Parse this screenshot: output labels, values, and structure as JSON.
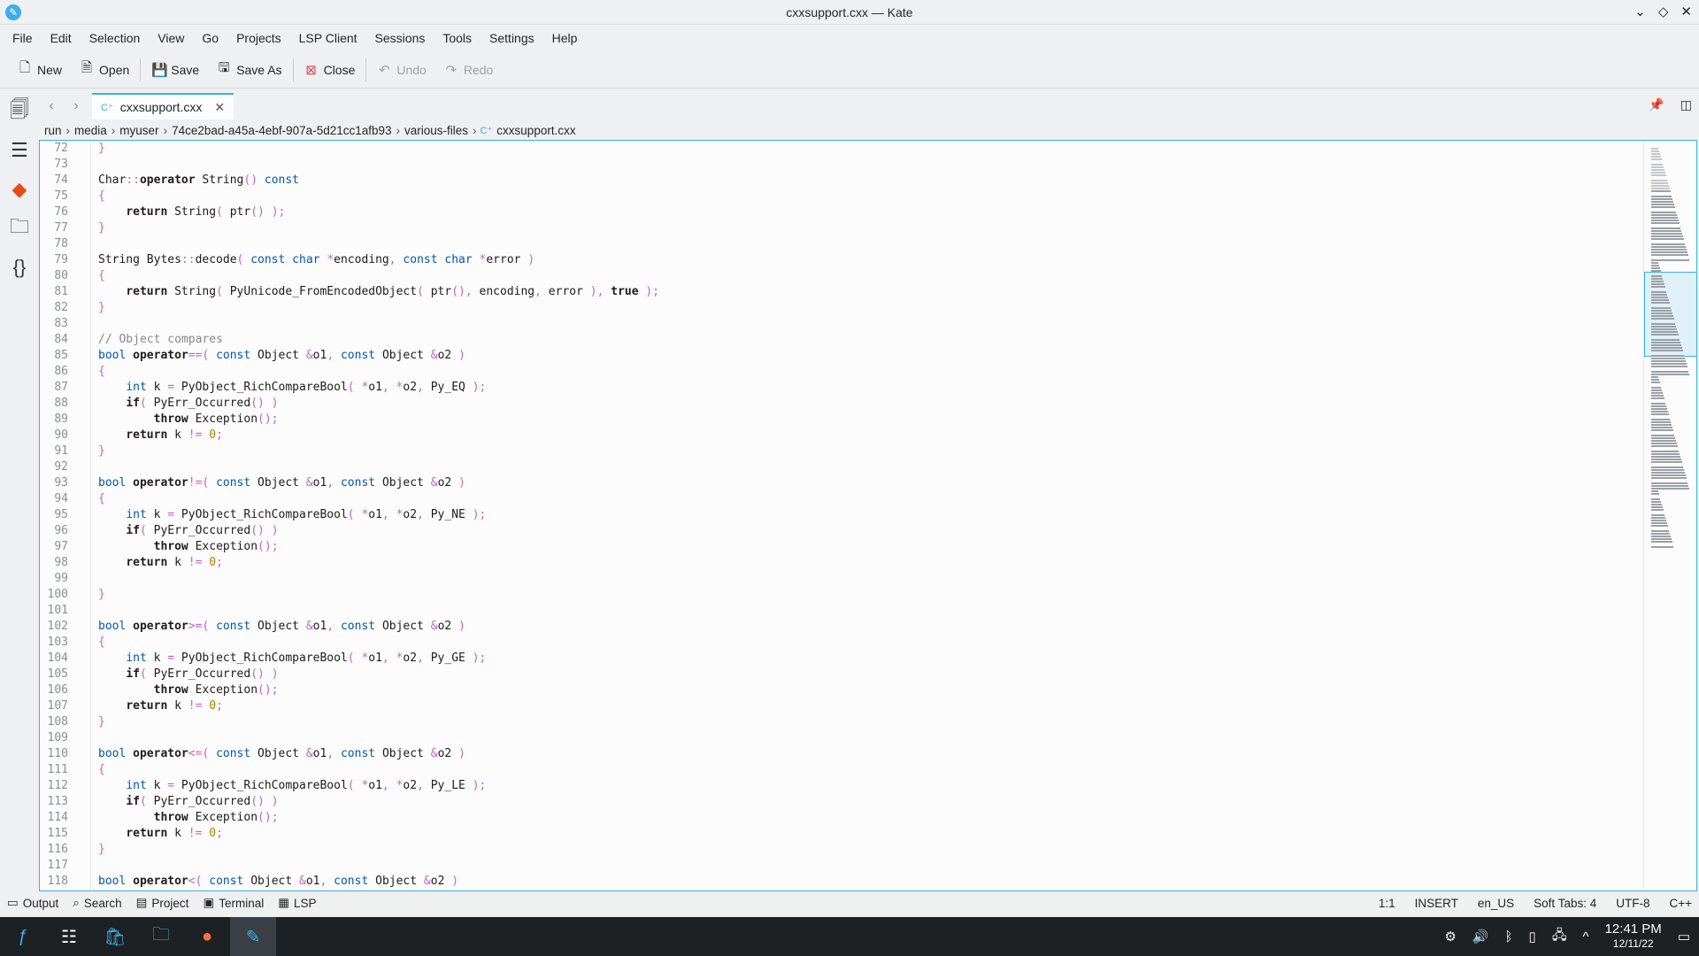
{
  "window": {
    "title": "cxxsupport.cxx — Kate"
  },
  "menu": [
    "File",
    "Edit",
    "Selection",
    "View",
    "Go",
    "Projects",
    "LSP Client",
    "Sessions",
    "Tools",
    "Settings",
    "Help"
  ],
  "toolbar": {
    "new": "New",
    "open": "Open",
    "save": "Save",
    "save_as": "Save As",
    "close": "Close",
    "undo": "Undo",
    "redo": "Redo"
  },
  "tab": {
    "label": "cxxsupport.cxx"
  },
  "breadcrumb": [
    "run",
    "media",
    "myuser",
    "74ce2bad-a45a-4ebf-907a-5d21cc1afb93",
    "various-files",
    "cxxsupport.cxx"
  ],
  "code": [
    {
      "n": "72",
      "t": "}"
    },
    {
      "n": "73",
      "t": ""
    },
    {
      "n": "74",
      "t": "Char::operator String() const"
    },
    {
      "n": "75",
      "t": "{"
    },
    {
      "n": "76",
      "t": "    return String( ptr() );"
    },
    {
      "n": "77",
      "t": "}"
    },
    {
      "n": "78",
      "t": ""
    },
    {
      "n": "79",
      "t": "String Bytes::decode( const char *encoding, const char *error )"
    },
    {
      "n": "80",
      "t": "{"
    },
    {
      "n": "81",
      "t": "    return String( PyUnicode_FromEncodedObject( ptr(), encoding, error ), true );"
    },
    {
      "n": "82",
      "t": "}"
    },
    {
      "n": "83",
      "t": ""
    },
    {
      "n": "84",
      "t": "// Object compares"
    },
    {
      "n": "85",
      "t": "bool operator==( const Object &o1, const Object &o2 )"
    },
    {
      "n": "86",
      "t": "{"
    },
    {
      "n": "87",
      "t": "    int k = PyObject_RichCompareBool( *o1, *o2, Py_EQ );"
    },
    {
      "n": "88",
      "t": "    if( PyErr_Occurred() )"
    },
    {
      "n": "89",
      "t": "        throw Exception();"
    },
    {
      "n": "90",
      "t": "    return k != 0;"
    },
    {
      "n": "91",
      "t": "}"
    },
    {
      "n": "92",
      "t": ""
    },
    {
      "n": "93",
      "t": "bool operator!=( const Object &o1, const Object &o2 )"
    },
    {
      "n": "94",
      "t": "{"
    },
    {
      "n": "95",
      "t": "    int k = PyObject_RichCompareBool( *o1, *o2, Py_NE );"
    },
    {
      "n": "96",
      "t": "    if( PyErr_Occurred() )"
    },
    {
      "n": "97",
      "t": "        throw Exception();"
    },
    {
      "n": "98",
      "t": "    return k != 0;"
    },
    {
      "n": "99",
      "t": ""
    },
    {
      "n": "100",
      "t": "}"
    },
    {
      "n": "101",
      "t": ""
    },
    {
      "n": "102",
      "t": "bool operator>=( const Object &o1, const Object &o2 )"
    },
    {
      "n": "103",
      "t": "{"
    },
    {
      "n": "104",
      "t": "    int k = PyObject_RichCompareBool( *o1, *o2, Py_GE );"
    },
    {
      "n": "105",
      "t": "    if( PyErr_Occurred() )"
    },
    {
      "n": "106",
      "t": "        throw Exception();"
    },
    {
      "n": "107",
      "t": "    return k != 0;"
    },
    {
      "n": "108",
      "t": "}"
    },
    {
      "n": "109",
      "t": ""
    },
    {
      "n": "110",
      "t": "bool operator<=( const Object &o1, const Object &o2 )"
    },
    {
      "n": "111",
      "t": "{"
    },
    {
      "n": "112",
      "t": "    int k = PyObject_RichCompareBool( *o1, *o2, Py_LE );"
    },
    {
      "n": "113",
      "t": "    if( PyErr_Occurred() )"
    },
    {
      "n": "114",
      "t": "        throw Exception();"
    },
    {
      "n": "115",
      "t": "    return k != 0;"
    },
    {
      "n": "116",
      "t": "}"
    },
    {
      "n": "117",
      "t": ""
    },
    {
      "n": "118",
      "t": "bool operator<( const Object &o1, const Object &o2 )"
    }
  ],
  "bottom_tabs": [
    "Output",
    "Search",
    "Project",
    "Terminal",
    "LSP"
  ],
  "status": {
    "cursor": "1:1",
    "mode": "INSERT",
    "lang": "en_US",
    "tabs": "Soft Tabs: 4",
    "encoding": "UTF-8",
    "syntax": "C++"
  },
  "clock": {
    "time": "12:41 PM",
    "date": "12/11/22"
  },
  "colors": {
    "accent": "#3daee9",
    "taskbar": "#1e2124"
  }
}
